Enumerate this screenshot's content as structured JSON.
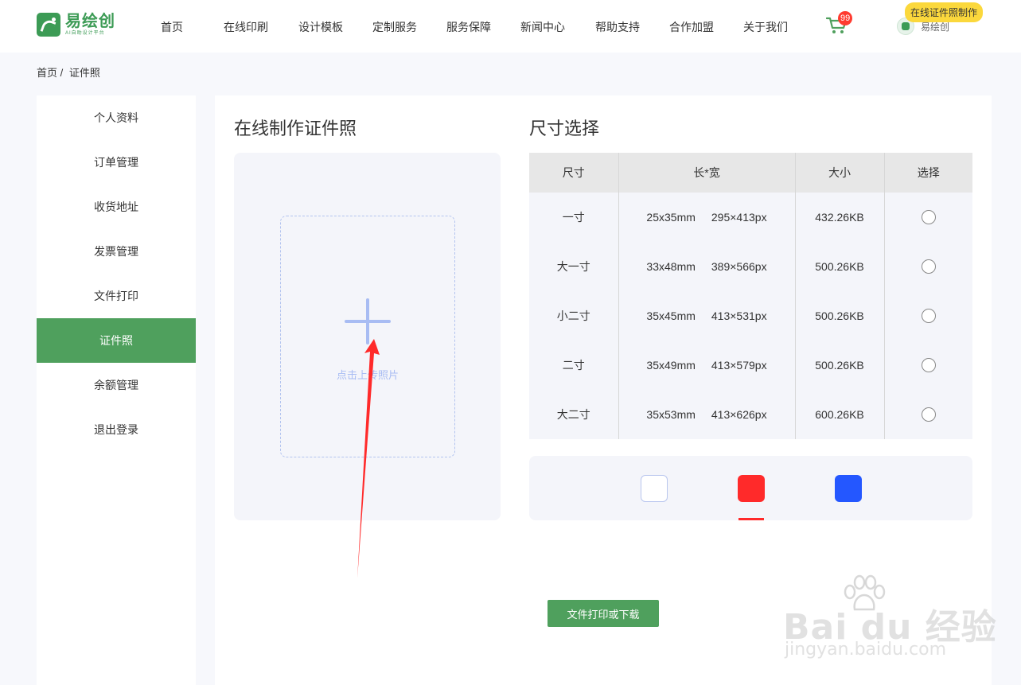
{
  "header": {
    "logo": {
      "name": "易绘创",
      "subtitle": "AI自助设计平台"
    },
    "nav": [
      "首页",
      "在线印刷",
      "设计模板",
      "定制服务",
      "服务保障",
      "新闻中心",
      "帮助支持",
      "合作加盟",
      "关于我们"
    ],
    "cart_badge": "99",
    "user_name": "易绘创",
    "tooltip": "在线证件照制作"
  },
  "breadcrumb": {
    "home": "首页 /",
    "current": "证件照"
  },
  "sidebar": {
    "items": [
      "个人资料",
      "订单管理",
      "收货地址",
      "发票管理",
      "文件打印",
      "证件照",
      "余额管理",
      "退出登录"
    ],
    "active_index": 5
  },
  "main": {
    "upload_title": "在线制作证件照",
    "upload_hint": "点击上传照片",
    "size_title": "尺寸选择",
    "table": {
      "headers": [
        "尺寸",
        "长*宽",
        "大小",
        "选择"
      ],
      "rows": [
        {
          "name": "一寸",
          "mm": "25x35mm",
          "px": "295×413px",
          "size": "432.26KB"
        },
        {
          "name": "大一寸",
          "mm": "33x48mm",
          "px": "389×566px",
          "size": "500.26KB"
        },
        {
          "name": "小二寸",
          "mm": "35x45mm",
          "px": "413×531px",
          "size": "500.26KB"
        },
        {
          "name": "二寸",
          "mm": "35x49mm",
          "px": "413×579px",
          "size": "500.26KB"
        },
        {
          "name": "大二寸",
          "mm": "35x53mm",
          "px": "413×626px",
          "size": "600.26KB"
        }
      ]
    },
    "colors": [
      {
        "name": "white",
        "hex": "#ffffff"
      },
      {
        "name": "red",
        "hex": "#ff2a2a"
      },
      {
        "name": "blue",
        "hex": "#2457ff"
      }
    ],
    "selected_color": "red",
    "print_button": "文件打印或下载"
  },
  "watermark": {
    "brand": "Bai du 经验",
    "url": "jingyan.baidu.com"
  },
  "theme": {
    "primary": "#4fa05d",
    "link": "#3a5cd7",
    "annotation": "#ff2a2a"
  }
}
